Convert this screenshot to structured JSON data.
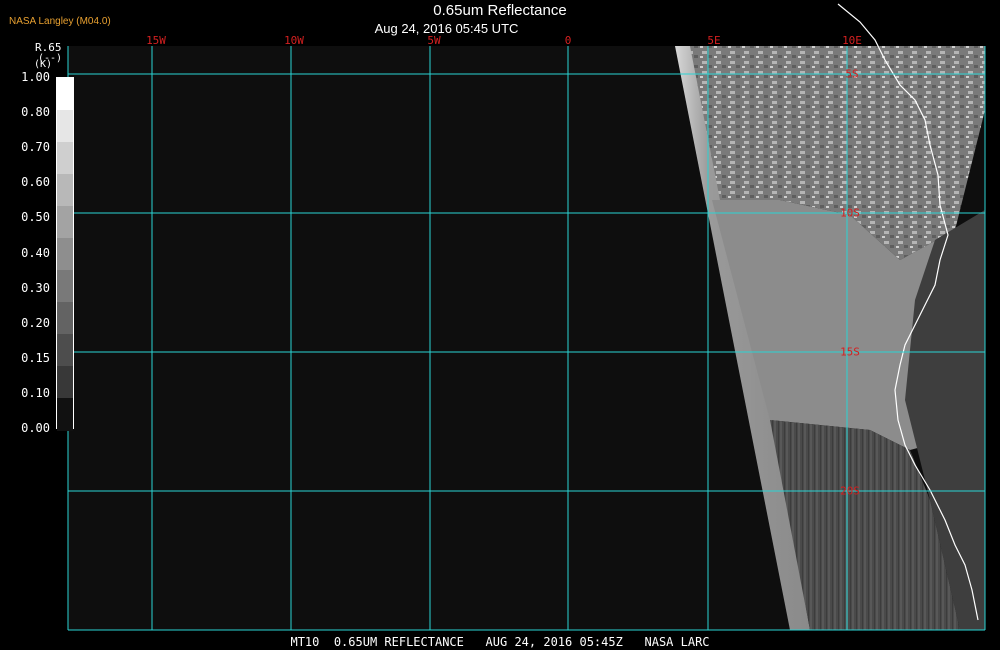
{
  "header": {
    "agency": "NASA Langley (M04.0)",
    "title": "0.65um Reflectance",
    "subtitle": "Aug 24, 2016 05:45 UTC"
  },
  "legend": {
    "title": "R.65",
    "unit_line1": "(--)",
    "unit_line2": "(K)",
    "ticks": [
      "1.00",
      "0.80",
      "0.70",
      "0.60",
      "0.50",
      "0.40",
      "0.30",
      "0.20",
      "0.15",
      "0.10",
      "0.00"
    ],
    "colors": [
      "#ffffff",
      "#e6e6e6",
      "#cfcfcf",
      "#b8b8b8",
      "#a3a3a3",
      "#8e8e8e",
      "#797979",
      "#636363",
      "#4d4d4d",
      "#383838",
      "#111111"
    ]
  },
  "map": {
    "longitude_labels": [
      "15W",
      "10W",
      "5W",
      "0",
      "5E",
      "10E"
    ],
    "latitude_labels": [
      "5S",
      "10S",
      "15S",
      "20S"
    ],
    "grid_color": "#2ad4d4",
    "label_color": "#d42020",
    "coastline_color": "#ffffff"
  },
  "footer": {
    "caption": "MT10  0.65UM REFLECTANCE   AUG 24, 2016 05:45Z   NASA LARC"
  }
}
